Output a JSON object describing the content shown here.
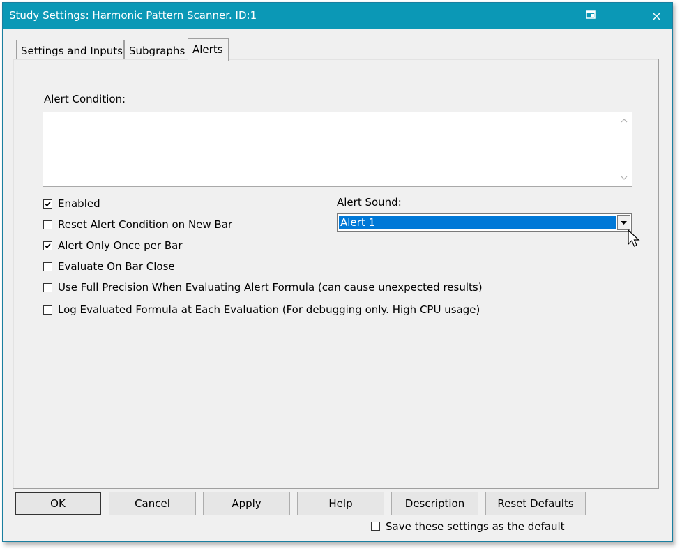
{
  "window": {
    "title": "Study Settings: Harmonic Pattern Scanner. ID:1"
  },
  "tabs": [
    {
      "label": "Settings and Inputs",
      "active": false
    },
    {
      "label": "Subgraphs",
      "active": false
    },
    {
      "label": "Alerts",
      "active": true
    }
  ],
  "alerts": {
    "condition_label": "Alert Condition:",
    "condition_value": "",
    "checkboxes": [
      {
        "label": "Enabled",
        "checked": true
      },
      {
        "label": "Reset Alert Condition on New Bar",
        "checked": false
      },
      {
        "label": "Alert Only Once per Bar",
        "checked": true
      },
      {
        "label": "Evaluate On Bar Close",
        "checked": false
      },
      {
        "label": "Use Full Precision When Evaluating Alert Formula (can cause unexpected results)",
        "checked": false
      },
      {
        "label": "Log Evaluated Formula at Each Evaluation (For debugging only. High CPU usage)",
        "checked": false
      }
    ],
    "sound_label": "Alert Sound:",
    "sound_value": "Alert 1"
  },
  "buttons": {
    "ok": "OK",
    "cancel": "Cancel",
    "apply": "Apply",
    "help": "Help",
    "description": "Description",
    "reset_defaults": "Reset Defaults"
  },
  "save_default": {
    "label": "Save these settings as the default",
    "checked": false
  },
  "colors": {
    "titlebar": "#0b98b6",
    "selection": "#0078d7",
    "dialog_bg": "#f0f0f0"
  },
  "icons": {
    "title": "window-restore-icon",
    "close": "close-icon",
    "dropdown": "chevron-down-icon"
  }
}
